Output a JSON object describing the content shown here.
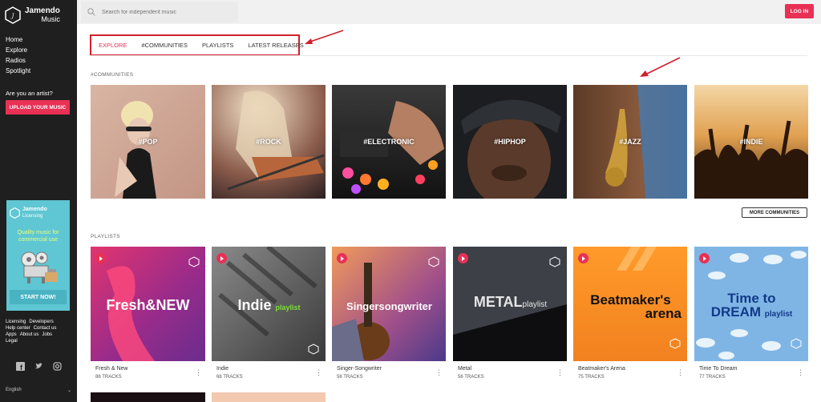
{
  "app": {
    "name_line1": "Jamendo",
    "name_line2": "Music"
  },
  "sidebar": {
    "nav": [
      "Home",
      "Explore",
      "Radios",
      "Spotlight"
    ],
    "artist_question": "Are you an artist?",
    "upload_label": "UPLOAD YOUR MUSIC",
    "licensing": {
      "logo_line1": "Jamendo",
      "logo_line2": "Licensing",
      "tagline_line1": "Quality music for",
      "tagline_line2": "commercial use",
      "cta": "START NOW!"
    },
    "footer_links": [
      "Licensing",
      "Developers",
      "Help center",
      "Contact us",
      "Apps",
      "About us",
      "Jobs",
      "Legal"
    ],
    "social_icons": [
      "facebook-icon",
      "twitter-icon",
      "instagram-icon"
    ],
    "language": "English"
  },
  "topbar": {
    "search_placeholder": "Search for independent music",
    "login_label": "LOG IN"
  },
  "tabs": [
    {
      "label": "EXPLORE",
      "active": true
    },
    {
      "label": "#COMMUNITIES",
      "active": false
    },
    {
      "label": "PLAYLISTS",
      "active": false
    },
    {
      "label": "LATEST RELEASES",
      "active": false
    }
  ],
  "communities": {
    "title": "#COMMUNITIES",
    "items": [
      "#POP",
      "#ROCK",
      "#ELECTRONIC",
      "#HIPHOP",
      "#JAZZ",
      "#INDIE"
    ],
    "more_label": "MORE COMMUNITIES"
  },
  "playlists": {
    "title": "PLAYLISTS",
    "items": [
      {
        "name": "Fresh & New",
        "tracks": "86 TRACKS",
        "art_text": "Fresh&NEW"
      },
      {
        "name": "Indie",
        "tracks": "68 TRACKS",
        "art_text": "Indie",
        "art_sub": "playlist"
      },
      {
        "name": "Singer-Songwriter",
        "tracks": "56 TRACKS",
        "art_text": "Singersongwriter"
      },
      {
        "name": "Metal",
        "tracks": "56 TRACKS",
        "art_text": "METAL",
        "art_sub": "playlist"
      },
      {
        "name": "Beatmaker's Arena",
        "tracks": "75 TRACKS",
        "art_text": "Beatmaker's",
        "art_text2": "arena"
      },
      {
        "name": "Time To Dream",
        "tracks": "77 TRACKS",
        "art_text": "Time to",
        "art_text2": "DREAM",
        "art_sub": "playlist"
      }
    ]
  },
  "colors": {
    "accent": "#e83155",
    "sidebar": "#1f1f1f",
    "licensing": "#5fc6d3",
    "annotation": "#d11f2b"
  }
}
